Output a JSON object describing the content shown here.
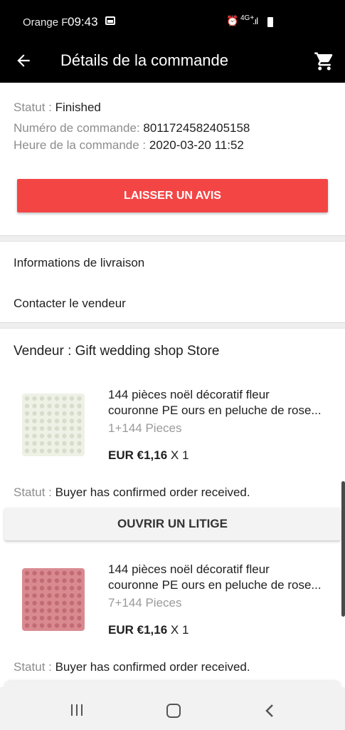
{
  "status_bar": {
    "carrier": "Orange F",
    "time": "09:43",
    "network": "4G+",
    "icons": [
      "gallery-icon",
      "alarm-icon",
      "signal-icon",
      "battery-icon"
    ]
  },
  "app_bar": {
    "title": "Détails de la commande",
    "icons": [
      "back-arrow-icon",
      "cart-icon"
    ]
  },
  "order": {
    "status_label": "Statut : ",
    "status_value": "Finished",
    "number_label": "Numéro de commande: ",
    "number_value": "8011724582405158",
    "time_label": "Heure de la commande : ",
    "time_value": "2020-03-20 11:52"
  },
  "actions": {
    "review_label": "LAISSER UN AVIS",
    "dispute_label": "OUVRIR UN LITIGE"
  },
  "links": {
    "delivery_info": "Informations de livraison",
    "contact_seller": "Contacter le vendeur"
  },
  "seller": {
    "label": "Vendeur : Gift wedding shop Store"
  },
  "items": [
    {
      "name_line1": "144 pièces noël décoratif fleur",
      "name_line2": "couronne PE ours en peluche de rose...",
      "variant": "1+144 Pieces",
      "price": "EUR €1,16",
      "qty": " X 1",
      "status_label": "Statut : ",
      "status_value": "Buyer has confirmed order received.",
      "thumb_color": "#eef1e6"
    },
    {
      "name_line1": "144 pièces noël décoratif fleur",
      "name_line2": "couronne PE ours en peluche de rose...",
      "variant": "7+144 Pieces",
      "price": "EUR €1,16",
      "qty": " X 1",
      "status_label": "Statut : ",
      "status_value": "Buyer has confirmed order received.",
      "thumb_color": "#d98a90"
    }
  ],
  "colors": {
    "accent": "#f44545",
    "header_bg": "#000000"
  }
}
